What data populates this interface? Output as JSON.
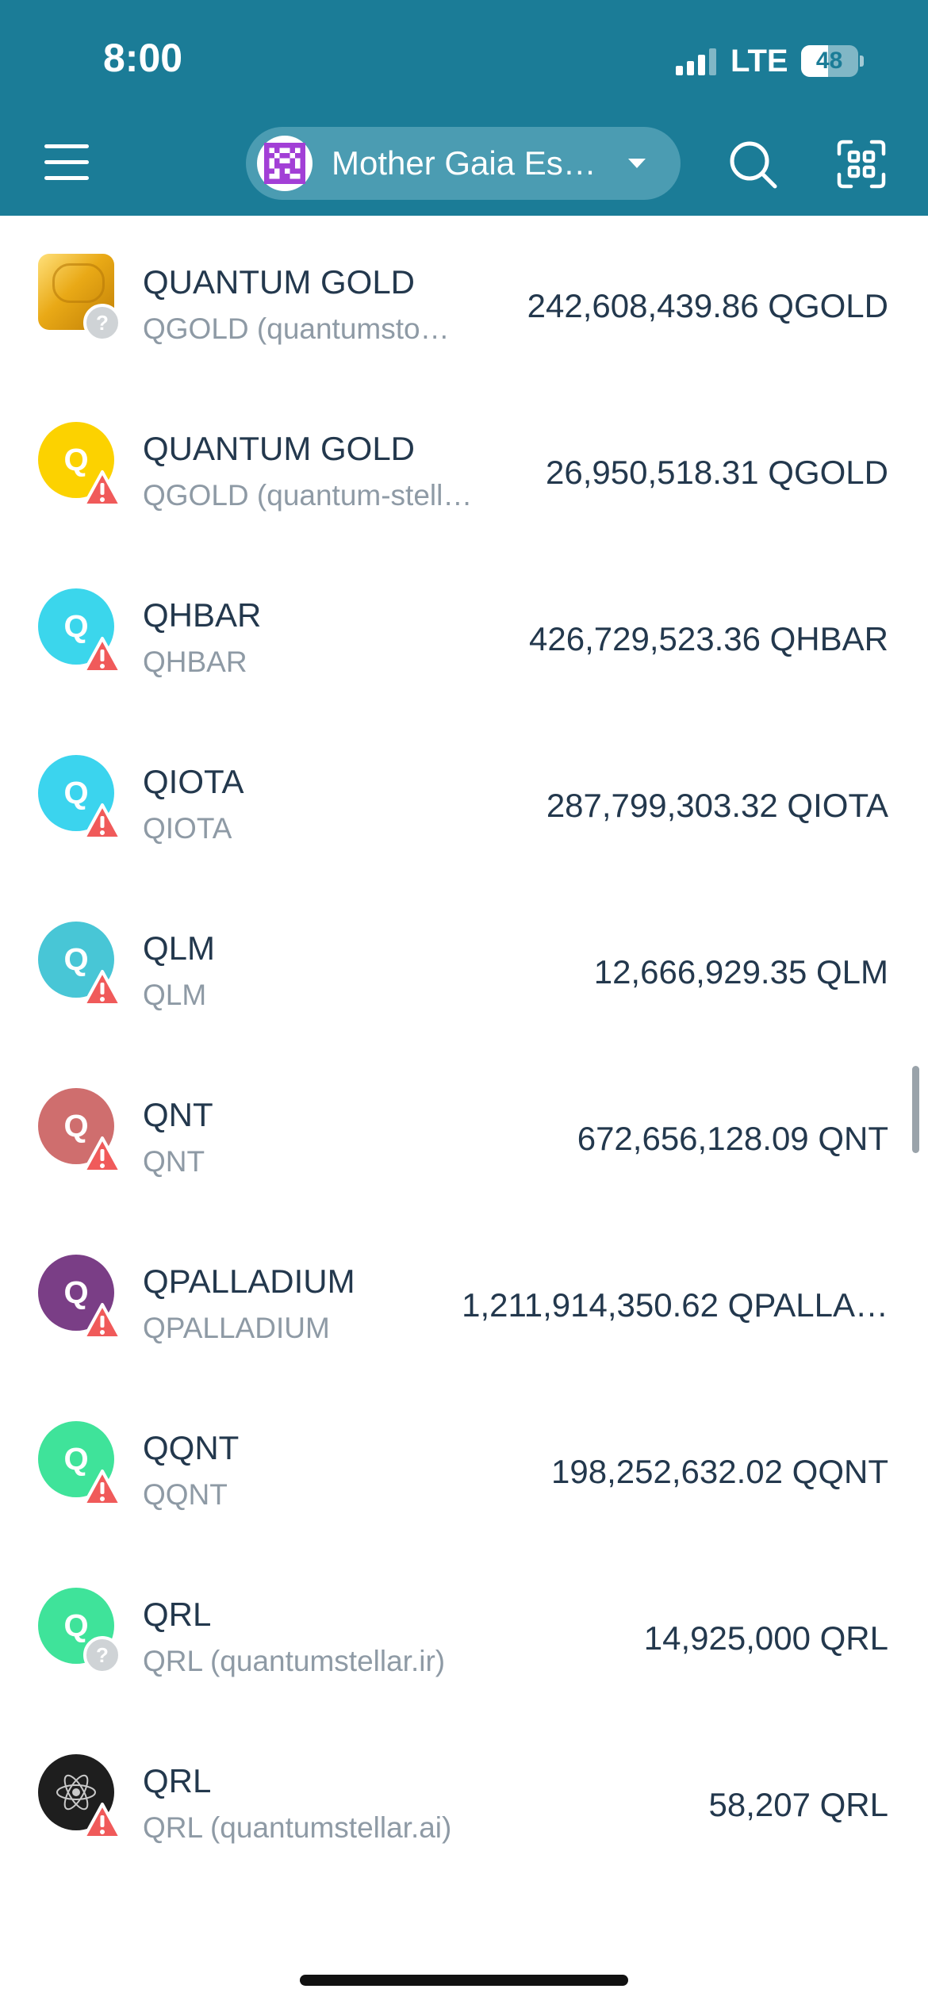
{
  "status_bar": {
    "time": "8:00",
    "network": "LTE",
    "battery": "48",
    "battery_level": 0.48
  },
  "header": {
    "wallet_name": "Mother Gaia Es…",
    "icons": [
      "menu-icon",
      "search-icon",
      "qr-scan-icon"
    ]
  },
  "tokens": [
    {
      "name": "QUANTUM GOLD",
      "sub": "QGOLD (quantumsto…",
      "balance": "242,608,439.86 QGOLD",
      "icon_type": "gold-bar",
      "badge": "unknown",
      "color": "#e9a916"
    },
    {
      "name": "QUANTUM GOLD",
      "sub": "QGOLD (quantum-stell…",
      "balance": "26,950,518.31 QGOLD",
      "icon_type": "letter",
      "letter": "Q",
      "badge": "warning",
      "color": "#fcd200"
    },
    {
      "name": "QHBAR",
      "sub": "QHBAR",
      "balance": "426,729,523.36 QHBAR",
      "icon_type": "letter",
      "letter": "Q",
      "badge": "warning",
      "color": "#3bd6ec"
    },
    {
      "name": "QIOTA",
      "sub": "QIOTA",
      "balance": "287,799,303.32 QIOTA",
      "icon_type": "letter",
      "letter": "Q",
      "badge": "warning",
      "color": "#3bd4ee"
    },
    {
      "name": "QLM",
      "sub": "QLM",
      "balance": "12,666,929.35 QLM",
      "icon_type": "letter",
      "letter": "Q",
      "badge": "warning",
      "color": "#48c6d6"
    },
    {
      "name": "QNT",
      "sub": "QNT",
      "balance": "672,656,128.09 QNT",
      "icon_type": "letter",
      "letter": "Q",
      "badge": "warning",
      "color": "#cf6e6e"
    },
    {
      "name": "QPALLADIUM",
      "sub": "QPALLADIUM",
      "balance": "1,211,914,350.62 QPALLA…",
      "icon_type": "letter",
      "letter": "Q",
      "badge": "warning",
      "color": "#7a3e86"
    },
    {
      "name": "QQNT",
      "sub": "QQNT",
      "balance": "198,252,632.02 QQNT",
      "icon_type": "letter",
      "letter": "Q",
      "badge": "warning",
      "color": "#3fe39a"
    },
    {
      "name": "QRL",
      "sub": "QRL (quantumstellar.ir)",
      "balance": "14,925,000 QRL",
      "icon_type": "letter",
      "letter": "Q",
      "badge": "unknown",
      "color": "#3fe39a"
    },
    {
      "name": "QRL",
      "sub": "QRL (quantumstellar.ai)",
      "balance": "58,207 QRL",
      "icon_type": "atom",
      "badge": "warning",
      "color": "#1e1e1e"
    }
  ]
}
